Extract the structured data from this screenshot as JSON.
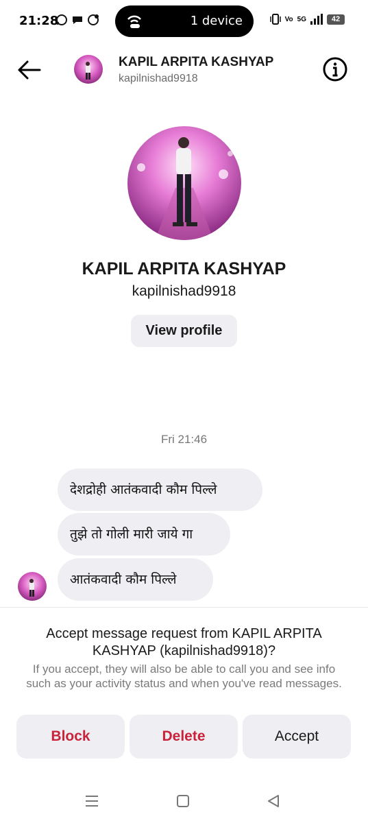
{
  "status_bar": {
    "time": "21:28",
    "island_text": "1 device",
    "network_badge": "5G",
    "volte": "Vo",
    "battery": "42",
    "icons": [
      "whatsapp-icon",
      "chat-icon",
      "whatsapp-business-icon",
      "hotspot-icon",
      "vibrate-icon",
      "signal-icon",
      "battery-icon"
    ]
  },
  "header": {
    "name": "KAPIL ARPITA KASHYAP",
    "username": "kapilnishad9918"
  },
  "profile": {
    "name": "KAPIL ARPITA KASHYAP",
    "username": "kapilnishad9918",
    "view_profile_label": "View profile"
  },
  "chat": {
    "timestamp": "Fri 21:46",
    "messages": [
      "देशद्रोही आतंकवादी कौम पिल्ले",
      "तुझे तो गोली मारी जाये गा",
      "आतंकवादी कौम पिल्ले"
    ]
  },
  "request": {
    "title": "Accept message request from KAPIL ARPITA KASHYAP (kapilnishad9918)?",
    "description": "If you accept, they will also be able to call you and see info such as your activity status and when you've read messages.",
    "block_label": "Block",
    "delete_label": "Delete",
    "accept_label": "Accept"
  },
  "colors": {
    "danger": "#c8233a",
    "button_bg": "#efeff3",
    "muted_text": "#7a7a7a"
  }
}
